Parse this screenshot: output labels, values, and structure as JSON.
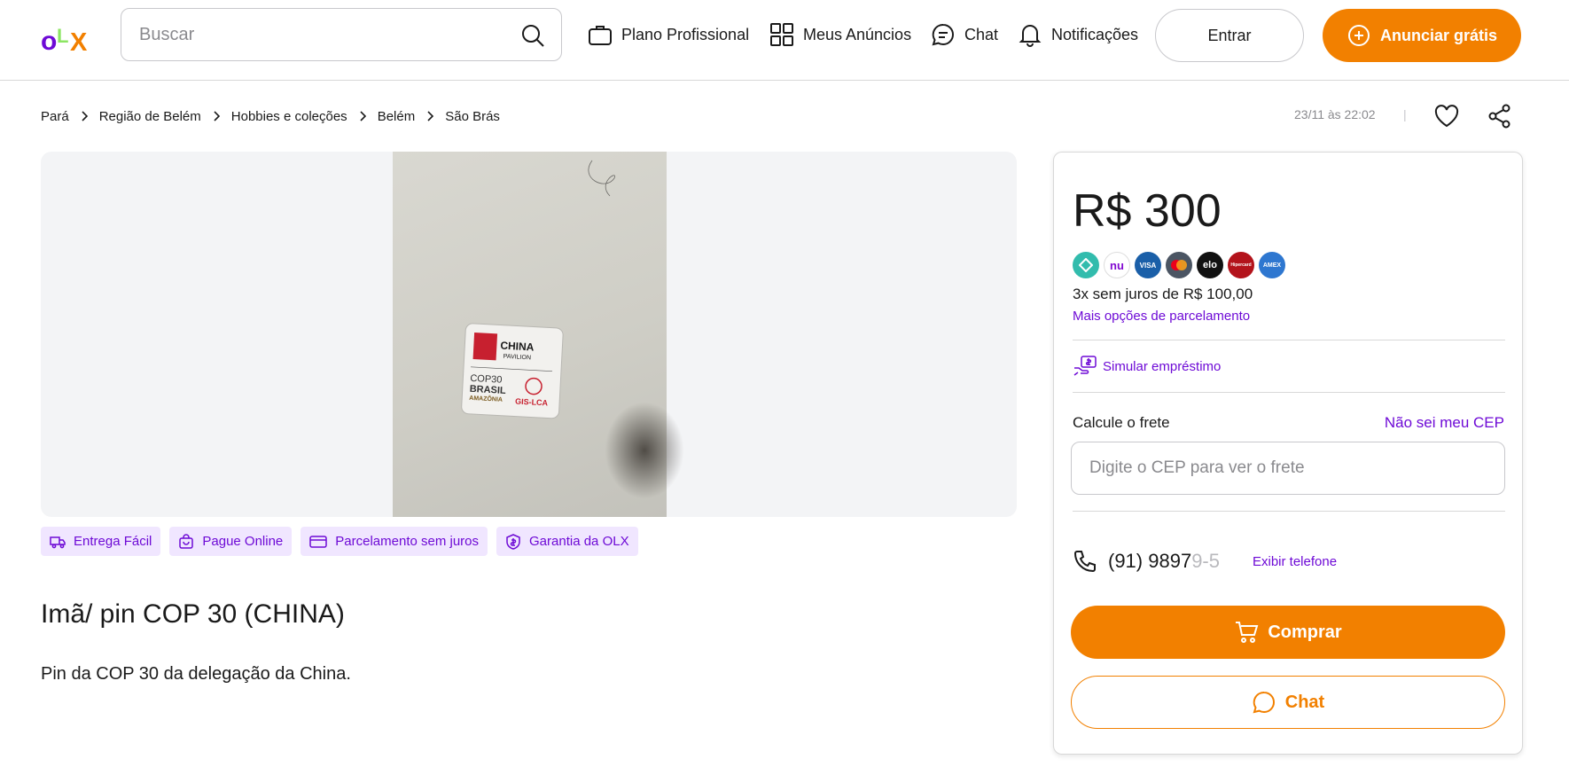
{
  "header": {
    "logo": {
      "o": "o",
      "l": "L",
      "x": "X"
    },
    "search_placeholder": "Buscar",
    "nav": {
      "plano": "Plano Profissional",
      "anuncios": "Meus Anúncios",
      "chat": "Chat",
      "notificacoes": "Notificações"
    },
    "login_label": "Entrar",
    "post_ad_label": "Anunciar grátis"
  },
  "breadcrumb": [
    "Pará",
    "Região de Belém",
    "Hobbies e coleções",
    "Belém",
    "São Brás"
  ],
  "posted_at": "23/11 às 22:02",
  "pipe": "|",
  "badges": {
    "entrega": "Entrega Fácil",
    "pague": "Pague Online",
    "parcelamento": "Parcelamento sem juros",
    "garantia": "Garantia da OLX"
  },
  "ad": {
    "title": "Imã/ pin COP 30 (CHINA)",
    "description": "Pin da COP 30 da delegação da China."
  },
  "sidebar": {
    "price": "R$ 300",
    "payment_methods": {
      "pix": "",
      "nu": "nu",
      "visa": "VISA",
      "mastercard": "",
      "elo": "elo",
      "hipercard": "Hipercard",
      "amex": "AMEX"
    },
    "installments": "3x sem juros de R$ 100,00",
    "more_installments": "Mais opções de parcelamento",
    "loan": "Simular empréstimo",
    "shipping_label": "Calcule o frete",
    "unknown_cep": "Não sei meu CEP",
    "cep_placeholder": "Digite o CEP para ver o frete",
    "phone_visible": "(91) 9897",
    "phone_faded": "9-5",
    "show_phone": "Exibir telefone",
    "buy_label": "Comprar",
    "chat_label": "Chat"
  },
  "pin_image": {
    "china": "CHINA",
    "pavilion": "PAVILION",
    "cop": "COP30",
    "brasil": "BRASIL",
    "amazonia": "AMAZÔNIA",
    "gis": "GIS-LCA"
  },
  "colors": {
    "brand_orange": "#f28000",
    "brand_purple": "#6e0ad6",
    "badge_bg": "#f0e6ff"
  }
}
